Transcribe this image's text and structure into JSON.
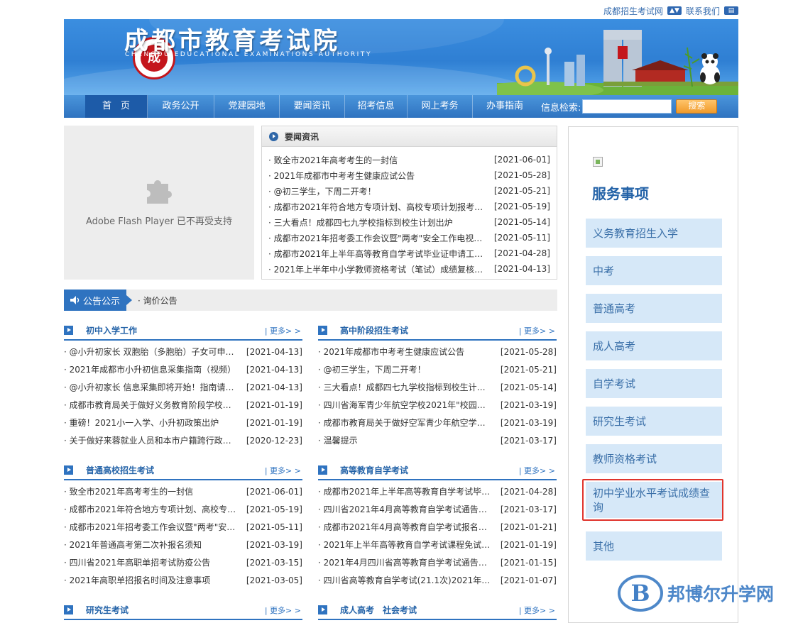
{
  "top_links": {
    "site": "成都招生考试网",
    "contact": "联系我们"
  },
  "banner": {
    "title_cn": "成都市教育考试院",
    "title_en": "CHENGDU EDUCATIONAL EXAMINATIONS AUTHORITY",
    "seal_char": "成"
  },
  "nav": {
    "items": [
      "首　页",
      "政务公开",
      "党建园地",
      "要闻资讯",
      "招考信息",
      "网上考务",
      "办事指南"
    ],
    "search_label": "信息检索:",
    "search_button": "搜索"
  },
  "flash": {
    "message": "Adobe Flash Player 已不再受支持"
  },
  "news": {
    "title": "要闻资讯",
    "items": [
      {
        "title": "· 致全市2021年高考考生的一封信",
        "date": "[2021-06-01]"
      },
      {
        "title": "· 2021年成都市中考考生健康应试公告",
        "date": "[2021-05-28]"
      },
      {
        "title": "· @初三学生，下周二开考！",
        "date": "[2021-05-21]"
      },
      {
        "title": "· 成都市2021年符合地方专项计划、高校专项计划报考条...",
        "date": "[2021-05-19]"
      },
      {
        "title": "· 三大看点！成都四七九学校指标到校生计划出炉",
        "date": "[2021-05-14]"
      },
      {
        "title": "· 成都市2021年招考委工作会议暨\"两考\"安全工作电视电...",
        "date": "[2021-05-11]"
      },
      {
        "title": "· 成都市2021年上半年高等教育自学考试毕业证申请工作...",
        "date": "[2021-04-28]"
      },
      {
        "title": "· 2021年上半年中小学教师资格考试（笔试）成绩复核工...",
        "date": "[2021-04-13]"
      }
    ]
  },
  "notice": {
    "tab": "公告公示",
    "text": "· 询价公告"
  },
  "more_label": "| 更多> >",
  "categories": {
    "junior": {
      "title": "初中入学工作",
      "items": [
        {
          "title": "· @小升初家长 双胞胎（多胞胎）子女可申请...",
          "date": "[2021-04-13]"
        },
        {
          "title": "· 2021年成都市小升初信息采集指南（视频）",
          "date": "[2021-04-13]"
        },
        {
          "title": "· @小升初家长 信息采集即将开始！指南请收...",
          "date": "[2021-04-13]"
        },
        {
          "title": "· 成都市教育局关于做好义务教育阶段学校招...",
          "date": "[2021-01-19]"
        },
        {
          "title": "· 重磅！2021小一入学、小升初政策出炉",
          "date": "[2021-01-19]"
        },
        {
          "title": "· 关于做好来蓉就业人员和本市户籍跨行政区...",
          "date": "[2020-12-23]"
        }
      ]
    },
    "senior": {
      "title": "高中阶段招生考试",
      "items": [
        {
          "title": "· 2021年成都市中考考生健康应试公告",
          "date": "[2021-05-28]"
        },
        {
          "title": "· @初三学生，下周二开考！",
          "date": "[2021-05-21]"
        },
        {
          "title": "· 三大看点！成都四七九学校指标到校生计划...",
          "date": "[2021-05-14]"
        },
        {
          "title": "· 四川省海军青少年航空学校2021年\"校园开...",
          "date": "[2021-03-19]"
        },
        {
          "title": "· 成都市教育局关于做好空军青少年航空学校...",
          "date": "[2021-03-19]"
        },
        {
          "title": "· 温馨提示",
          "date": "[2021-03-17]"
        }
      ]
    },
    "college": {
      "title": "普通高校招生考试",
      "items": [
        {
          "title": "· 致全市2021年高考考生的一封信",
          "date": "[2021-06-01]"
        },
        {
          "title": "· 成都市2021年符合地方专项计划、高校专项...",
          "date": "[2021-05-19]"
        },
        {
          "title": "· 成都市2021年招考委工作会议暨\"两考\"安全...",
          "date": "[2021-05-11]"
        },
        {
          "title": "· 2021年普通高考第二次补报名须知",
          "date": "[2021-03-19]"
        },
        {
          "title": "· 四川省2021年高职单招考试防疫公告",
          "date": "[2021-03-15]"
        },
        {
          "title": "· 2021年高职单招报名时间及注意事项",
          "date": "[2021-03-05]"
        }
      ]
    },
    "selfstudy": {
      "title": "高等教育自学考试",
      "items": [
        {
          "title": "· 成都市2021年上半年高等教育自学考试毕业...",
          "date": "[2021-04-28]"
        },
        {
          "title": "· 四川省2021年4月高等教育自学考试通告（...",
          "date": "[2021-03-17]"
        },
        {
          "title": "· 成都市2021年4月高等教育自学考试报名工...",
          "date": "[2021-01-21]"
        },
        {
          "title": "· 2021年上半年高等教育自学考试课程免试、...",
          "date": "[2021-01-19]"
        },
        {
          "title": "· 2021年4月四川省高等教育自学考试通告（...",
          "date": "[2021-01-15]"
        },
        {
          "title": "· 四川省高等教育自学考试(21.1次)2021年4...",
          "date": "[2021-01-07]"
        }
      ]
    },
    "graduate": {
      "title": "研究生考试"
    },
    "adult": {
      "title": "成人高考　社会考试"
    }
  },
  "sidebar": {
    "title": "服务事项",
    "items": [
      "义务教育招生入学",
      "中考",
      "普通高考",
      "成人高考",
      "自学考试",
      "研究生考试",
      "教师资格考试",
      "初中学业水平考试成绩查询",
      "其他"
    ]
  },
  "watermark": {
    "text": "邦博尔升学网",
    "letter": "B"
  },
  "colors": {
    "primary": "#2f73c0",
    "accent_orange": "#f09a2a",
    "highlight_red": "#e0342c",
    "sidebar_item_bg": "#d6e8f8"
  }
}
